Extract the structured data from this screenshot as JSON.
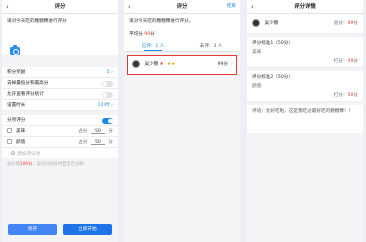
{
  "panel1": {
    "title": "评分",
    "back_icon": "‹",
    "prompt": "请对今天吃的糖糖粿进行评分",
    "rows": [
      {
        "label": "积分奖励",
        "value": "5 ›"
      },
      {
        "label": "去掉最低分和最高分"
      },
      {
        "label": "允许查看评分统计"
      },
      {
        "label": "设置时长",
        "value": "1小时 ›"
      }
    ],
    "split_label": "分项评分",
    "items": [
      {
        "label": "美味",
        "prefix": "占分",
        "value": "50",
        "unit": "分"
      },
      {
        "label": "颜值",
        "prefix": "占分",
        "value": "50",
        "unit": "分"
      }
    ],
    "add_item": "添加评分项",
    "total_prefix": "总分值",
    "total_value": "100分",
    "total_suffix": "，设分100分时显示百分制",
    "save_button": "保存",
    "start_button": "立即开始"
  },
  "panel2": {
    "title": "评分",
    "back_icon": "‹",
    "action": "结束",
    "prompt": "请对今天吃的糖糖粿进行评分。",
    "avg_label": "平均分",
    "avg_value": "99",
    "avg_unit": "分",
    "tab_done": "已评：1 人",
    "tab_pending": "未评：3 人",
    "student_name": "吴少锦",
    "student_badges": "★★",
    "student_badge_red": "❦",
    "student_score": "99分",
    "chevron": "›"
  },
  "panel3": {
    "title": "评分详情",
    "back_icon": "‹",
    "user_name": "吴少锦",
    "total_label": "总分：",
    "total_value": "99",
    "total_unit": "分",
    "standards": [
      {
        "title": "评分标准1（50分）",
        "value": "美味",
        "score_label": "打分：",
        "score": "49",
        "unit": "分"
      },
      {
        "title": "评分标准2（50分）",
        "value": "颜值",
        "score_label": "打分：",
        "score": "50",
        "unit": "分"
      }
    ],
    "comment": "评语：太好吃啦，这是我吃过最好吃的糖糖粿！！"
  }
}
